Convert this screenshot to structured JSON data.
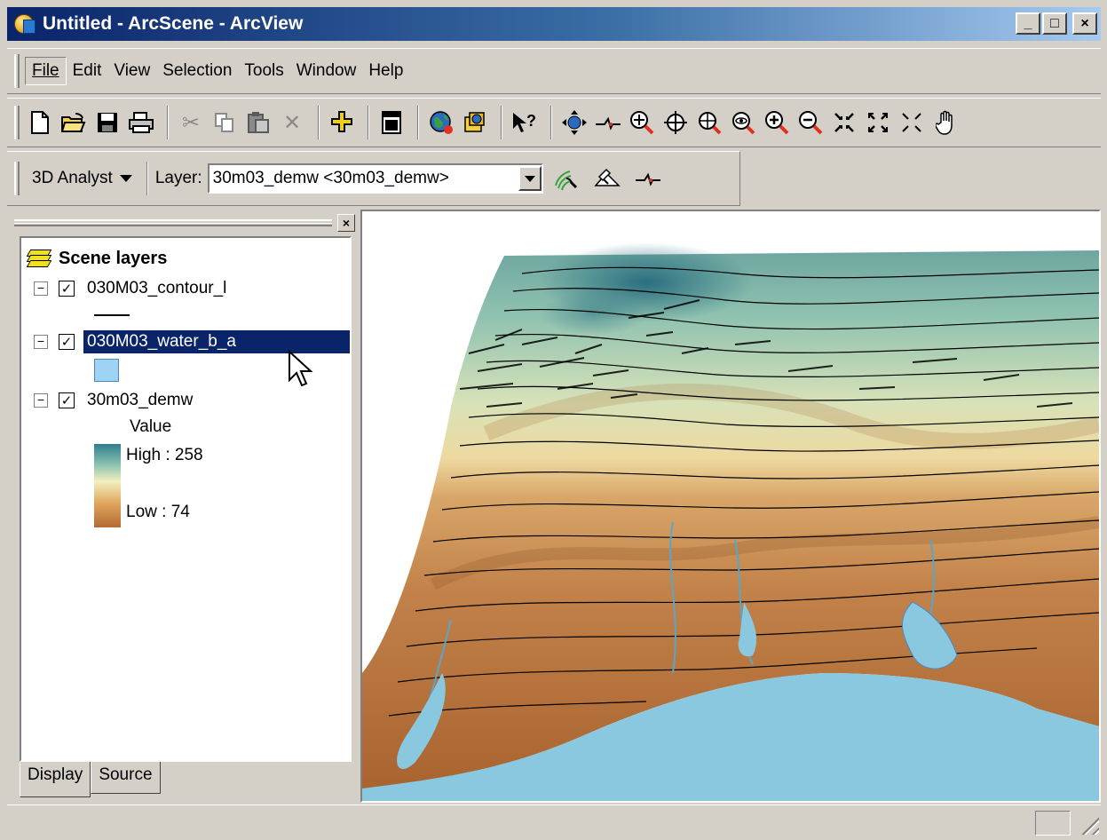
{
  "window": {
    "title": "Untitled - ArcScene - ArcView",
    "minimize": "_",
    "maximize": "□",
    "close": "×"
  },
  "menu": {
    "file": "File",
    "edit": "Edit",
    "view": "View",
    "selection": "Selection",
    "tools": "Tools",
    "window": "Window",
    "help": "Help"
  },
  "toolbar": {
    "icons": [
      "new-document-icon",
      "open-folder-icon",
      "save-icon",
      "print-icon",
      "cut-icon",
      "copy-icon",
      "paste-icon",
      "delete-icon",
      "add-data-icon",
      "scene-properties-icon",
      "globe-icon",
      "arccatalog-icon",
      "whats-this-icon",
      "navigate-icon",
      "fly-icon",
      "zoom-target-icon",
      "center-target-icon",
      "zoom-to-target-icon",
      "set-observer-icon",
      "zoom-in-icon",
      "zoom-out-icon",
      "full-extent-icon",
      "zoom-extent-icon",
      "pan-icon"
    ]
  },
  "analyst_toolbar": {
    "menu_label": "3D Analyst",
    "layer_label": "Layer:",
    "layer_value": "30m03_demw <30m03_demw>"
  },
  "toc": {
    "close": "×",
    "title": "Scene layers",
    "layers": [
      {
        "name": "030M03_contour_l",
        "checked": "✓",
        "expander": "−"
      },
      {
        "name": "030M03_water_b_a",
        "checked": "✓",
        "expander": "−"
      },
      {
        "name": "30m03_demw",
        "checked": "✓",
        "expander": "−"
      }
    ],
    "legend": {
      "title": "Value",
      "high": "High : 258",
      "low": "Low : 74"
    },
    "tabs": {
      "display": "Display",
      "source": "Source"
    }
  },
  "colors": {
    "title_bar": "#0a246a",
    "selection": "#0a246a",
    "water": "#8ac8e0",
    "high_elevation": "#2f7f8e",
    "low_elevation": "#b46a34"
  }
}
